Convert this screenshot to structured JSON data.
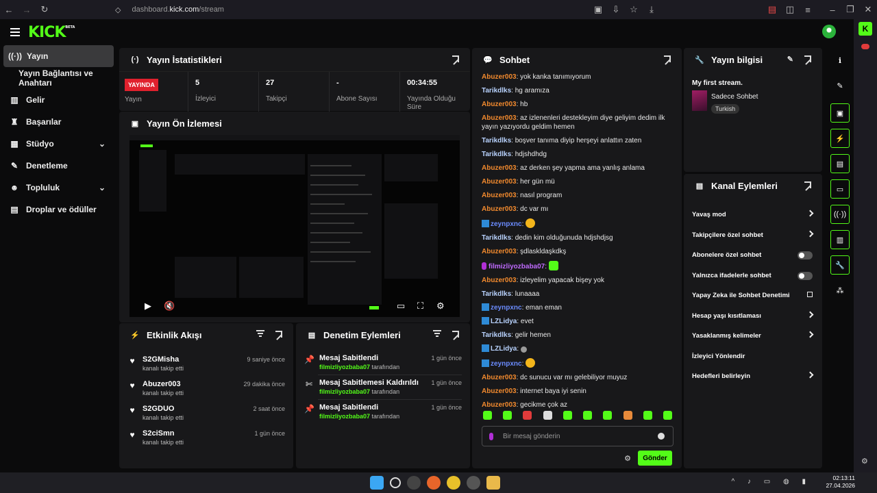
{
  "browser": {
    "url_prefix": "dashboard.",
    "url_domain": "kick.com",
    "url_path": "/stream",
    "ext_count": "4"
  },
  "brand": {
    "logo": "KICK",
    "beta": "BETA"
  },
  "sidebar": {
    "items": [
      {
        "label": "Yayın",
        "icon": "broadcast-icon"
      },
      {
        "label": "Yayın Bağlantısı ve Anahtarı",
        "icon": ""
      },
      {
        "label": "Gelir",
        "icon": "chart-icon"
      },
      {
        "label": "Başarılar",
        "icon": "trophy-icon"
      },
      {
        "label": "Stüdyo",
        "icon": "studio-icon"
      },
      {
        "label": "Denetleme",
        "icon": "wrench-icon"
      },
      {
        "label": "Topluluk",
        "icon": "users-icon"
      },
      {
        "label": "Droplar ve ödüller",
        "icon": "gift-icon"
      }
    ]
  },
  "stats_panel": {
    "title": "Yayın İstatistikleri",
    "live_badge": "YAYINDA",
    "live_label": "Yayın",
    "stats": [
      {
        "value": "5",
        "label": "İzleyici"
      },
      {
        "value": "27",
        "label": "Takipçi"
      },
      {
        "value": "-",
        "label": "Abone Sayısı"
      },
      {
        "value": "00:34:55",
        "label": "Yayında Olduğu Süre"
      }
    ]
  },
  "preview_panel": {
    "title": "Yayın Ön İzlemesi"
  },
  "activity_panel": {
    "title": "Etkinlik Akışı",
    "items": [
      {
        "name": "S2GMisha",
        "action": "kanalı takip etti",
        "time": "9 saniye önce"
      },
      {
        "name": "Abuzer003",
        "action": "kanalı takip etti",
        "time": "29 dakika önce"
      },
      {
        "name": "S2GDUO",
        "action": "kanalı takip etti",
        "time": "2 saat önce"
      },
      {
        "name": "S2ciSmn",
        "action": "kanalı takip etti",
        "time": "1 gün önce"
      }
    ]
  },
  "mod_panel": {
    "title": "Denetim Eylemleri",
    "items": [
      {
        "title": "Mesaj Sabitlendi",
        "actor": "filmizliyozbaba07",
        "by": "tarafından",
        "time": "1 gün önce"
      },
      {
        "title": "Mesaj Sabitlemesi Kaldırıldı",
        "actor": "filmizliyozbaba07",
        "by": "tarafından",
        "time": "1 gün önce"
      },
      {
        "title": "Mesaj Sabitlendi",
        "actor": "filmizliyozbaba07",
        "by": "tarafından",
        "time": "1 gün önce"
      }
    ]
  },
  "chat": {
    "title": "Sohbet",
    "messages": [
      {
        "user": "Abuzer003",
        "color": "#f28a2e",
        "text": "yok kanka tanımıyorum"
      },
      {
        "user": "Tarikdlks",
        "color": "#b9d3ff",
        "text": "hg aramıza"
      },
      {
        "user": "Abuzer003",
        "color": "#f28a2e",
        "text": "hb"
      },
      {
        "user": "Abuzer003",
        "color": "#f28a2e",
        "text": "az izlenenleri destekleyim diye geliyim dedim ilk yayın yazıyordu geldim hemen"
      },
      {
        "user": "Tarikdlks",
        "color": "#b9d3ff",
        "text": "boşver tanıma diyip herşeyi anlattın zaten"
      },
      {
        "user": "Tarikdlks",
        "color": "#b9d3ff",
        "text": "hdjshdhdg"
      },
      {
        "user": "Abuzer003",
        "color": "#f28a2e",
        "text": "az derken şey yapma ama yanlış anlama"
      },
      {
        "user": "Abuzer003",
        "color": "#f28a2e",
        "text": "her gün mü"
      },
      {
        "user": "Abuzer003",
        "color": "#f28a2e",
        "text": "nasıl program"
      },
      {
        "user": "Abuzer003",
        "color": "#f28a2e",
        "text": "dc var mı"
      },
      {
        "user": "zeynpxnc",
        "color": "#6b8cff",
        "text": "",
        "badge": "sub",
        "emote": "yellow"
      },
      {
        "user": "Tarikdlks",
        "color": "#b9d3ff",
        "text": "dedin kim olduğunuda hdjshdjsg"
      },
      {
        "user": "Abuzer003",
        "color": "#f28a2e",
        "text": "şdlaskldaşkdkş"
      },
      {
        "user": "filmizliyozbaba07",
        "color": "#c06bff",
        "text": "",
        "badge": "mic",
        "emote": "green"
      },
      {
        "user": "Abuzer003",
        "color": "#f28a2e",
        "text": "izleyelim yapacak bişey yok"
      },
      {
        "user": "Tarikdlks",
        "color": "#b9d3ff",
        "text": "lunaaaa"
      },
      {
        "user": "zeynpxnc",
        "color": "#6b8cff",
        "text": "eman eman",
        "badge": "sub"
      },
      {
        "user": "LZLidya",
        "color": "#b9d3ff",
        "text": "evet",
        "badge": "sub"
      },
      {
        "user": "Tarikdlks",
        "color": "#b9d3ff",
        "text": "gelir hemen"
      },
      {
        "user": "LZLidya",
        "color": "#b9d3ff",
        "text": "",
        "badge": "sub",
        "emote": "small"
      },
      {
        "user": "zeynpxnc",
        "color": "#6b8cff",
        "text": "",
        "badge": "sub",
        "emote": "yellow"
      },
      {
        "user": "Abuzer003",
        "color": "#f28a2e",
        "text": "dc sunucu var mı gelebiliyor muyuz"
      },
      {
        "user": "Abuzer003",
        "color": "#f28a2e",
        "text": "internet baya iyi senin"
      },
      {
        "user": "Abuzer003",
        "color": "#f28a2e",
        "text": "gecikme çok az"
      }
    ],
    "placeholder": "Bir mesaj gönderin",
    "send_label": "Gönder"
  },
  "info_panel": {
    "title": "Yayın bilgisi",
    "stream_title": "My first stream.",
    "category": "Sadece Sohbet",
    "tag": "Turkish"
  },
  "actions_panel": {
    "title": "Kanal Eylemleri",
    "items": [
      {
        "label": "Yavaş mod",
        "control": "arrow"
      },
      {
        "label": "Takipçilere özel sohbet",
        "control": "arrow"
      },
      {
        "label": "Abonelere özel sohbet",
        "control": "toggle"
      },
      {
        "label": "Yalnızca ifadelerle sohbet",
        "control": "toggle"
      },
      {
        "label": "Yapay Zeka ile Sohbet Denetimi",
        "control": "external"
      },
      {
        "label": "Hesap yaşı kısıtlaması",
        "control": "arrow"
      },
      {
        "label": "Yasaklanmış kelimeler",
        "control": "arrow"
      },
      {
        "label": "İzleyici Yönlendir",
        "control": "none"
      },
      {
        "label": "Hedefleri belirleyin",
        "control": "arrow"
      }
    ]
  },
  "taskbar": {
    "time": "02:13:11",
    "date": "27.04.2026"
  }
}
